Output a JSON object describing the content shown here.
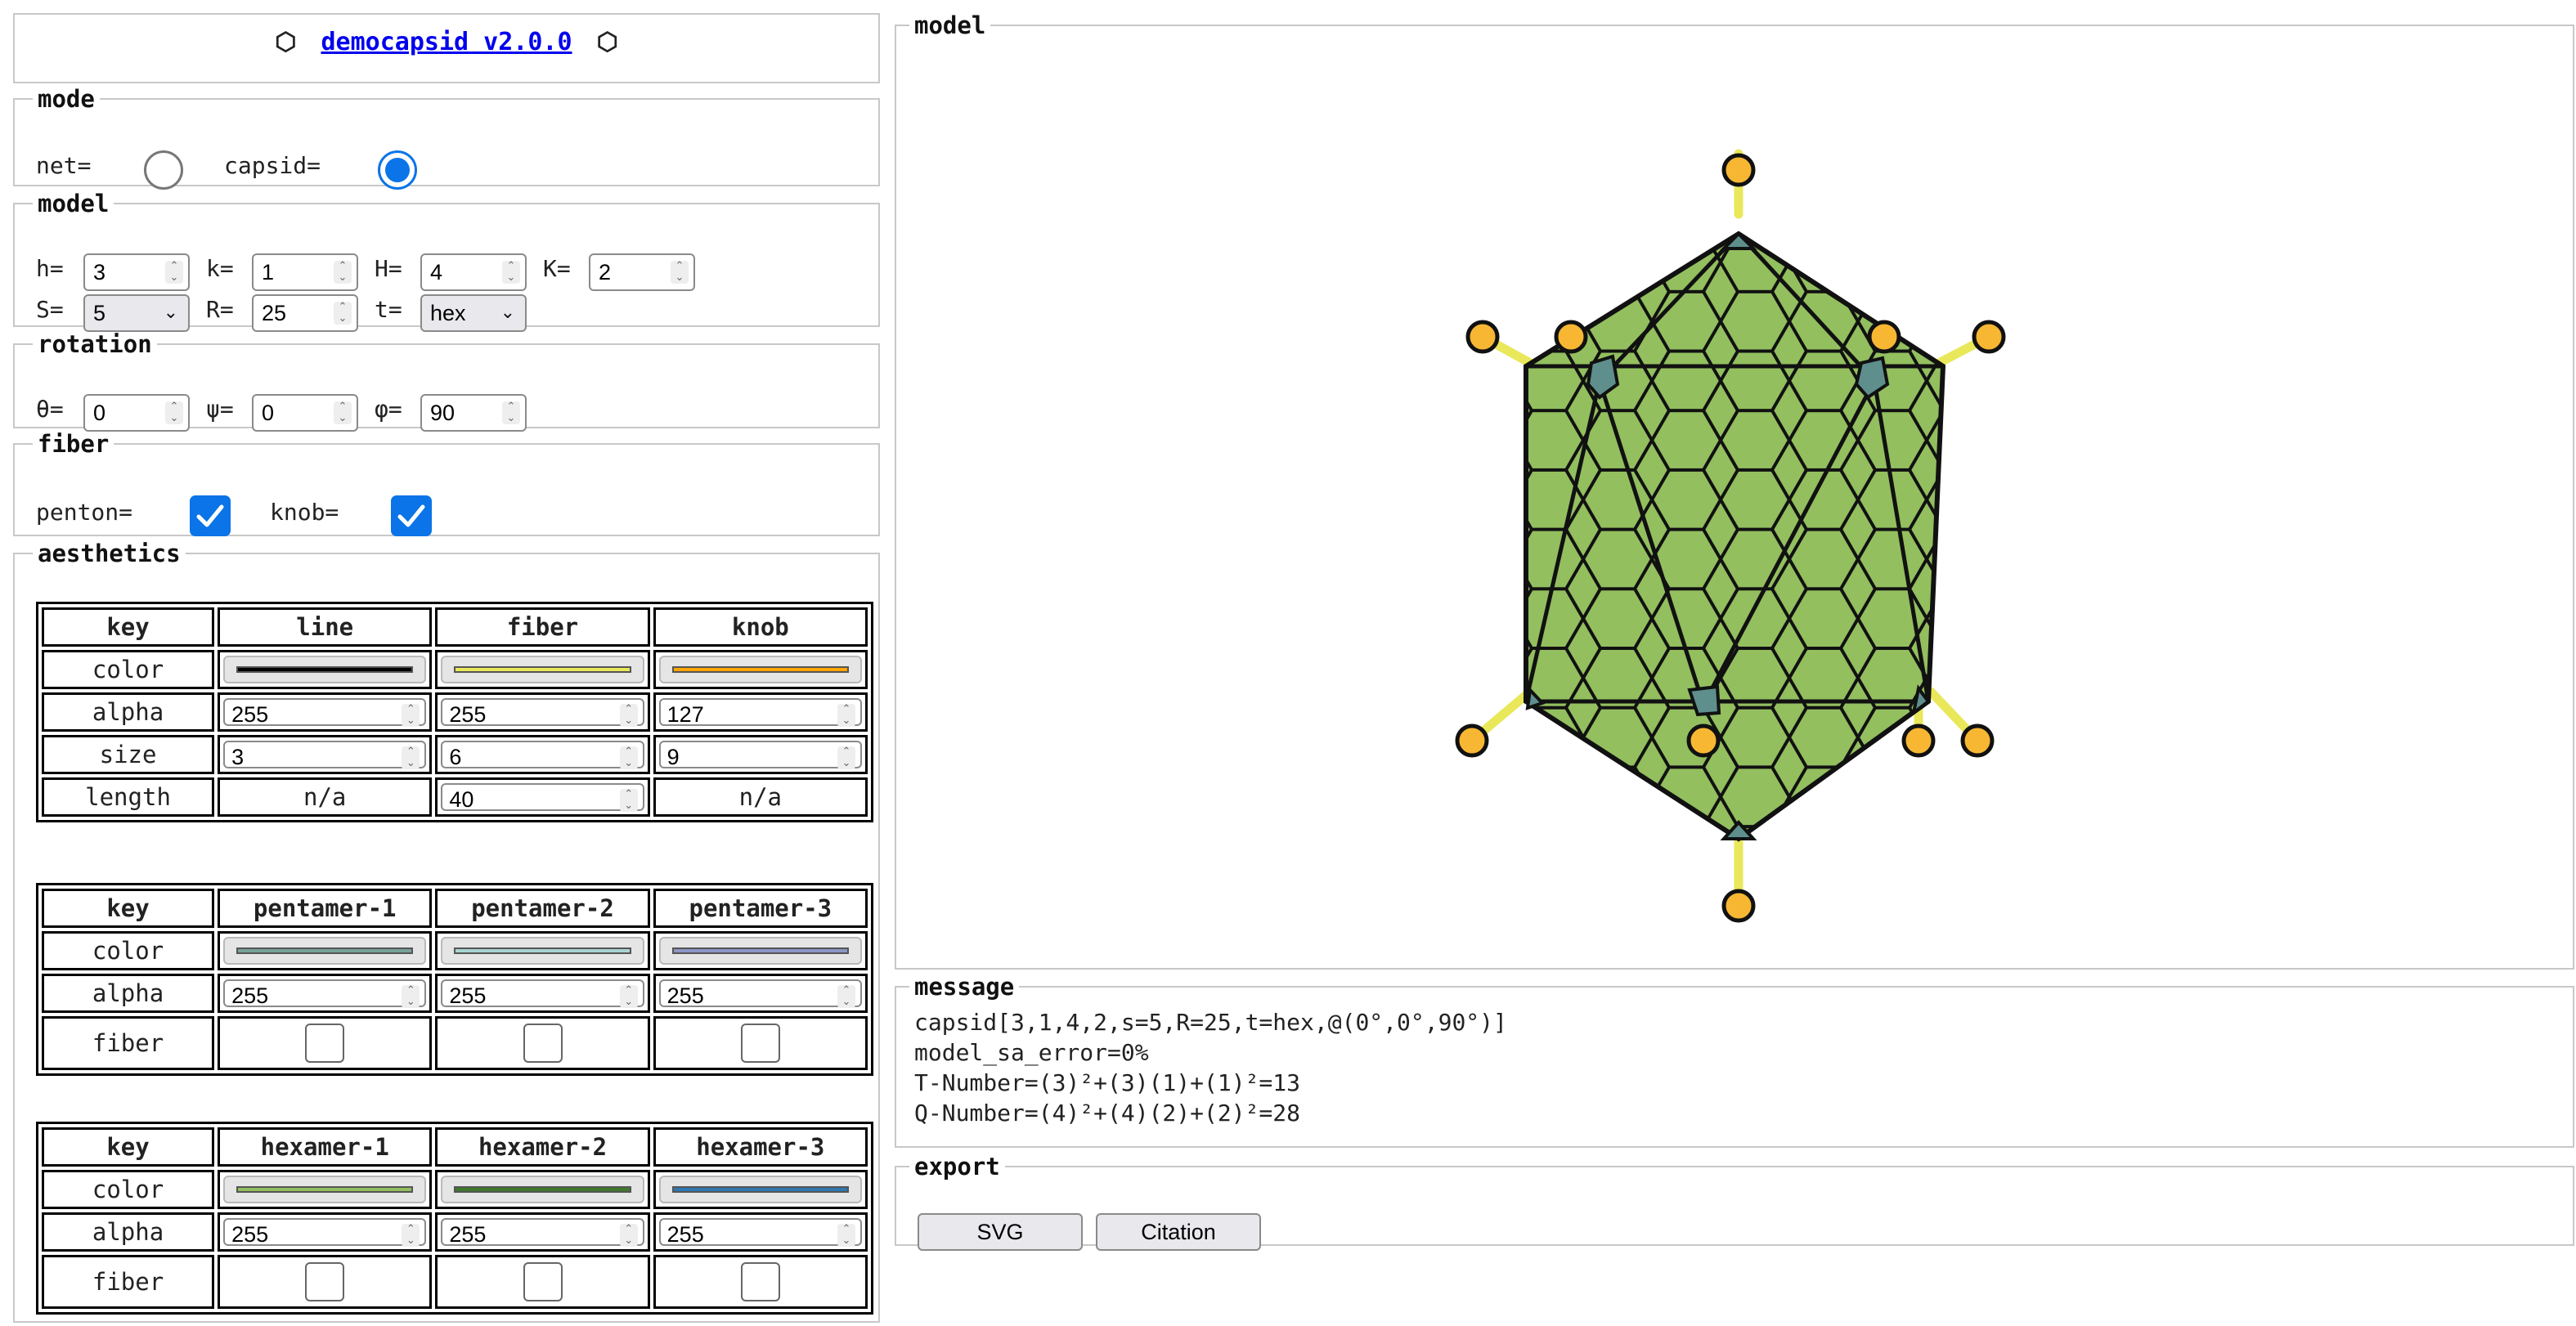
{
  "title": {
    "hex_left": "⬡",
    "link_text": "democapsid v2.0.0",
    "hex_right": "⬡"
  },
  "mode": {
    "legend": "mode",
    "net_label": "net=",
    "capsid_label": "capsid=",
    "selected": "capsid"
  },
  "model_panel": {
    "legend": "model",
    "h_label": "h=",
    "h_value": "3",
    "k_label": "k=",
    "k_value": "1",
    "H_label": "H=",
    "H_value": "4",
    "K_label": "K=",
    "K_value": "2",
    "S_label": "S=",
    "S_value": "5",
    "R_label": "R=",
    "R_value": "25",
    "t_label": "t=",
    "t_value": "hex"
  },
  "rotation": {
    "legend": "rotation",
    "theta_label": "θ=",
    "theta_value": "0",
    "psi_label": "ψ=",
    "psi_value": "0",
    "phi_label": "φ=",
    "phi_value": "90"
  },
  "fiber": {
    "legend": "fiber",
    "penton_label": "penton=",
    "penton_checked": true,
    "knob_label": "knob=",
    "knob_checked": true
  },
  "aesthetics": {
    "legend": "aesthetics",
    "table1": {
      "headers": [
        "key",
        "line",
        "fiber",
        "knob"
      ],
      "color_key": "color",
      "colors": [
        "#000000",
        "#e8e85a",
        "#ffa500"
      ],
      "alpha_key": "alpha",
      "alphas": [
        "255",
        "255",
        "127"
      ],
      "size_key": "size",
      "sizes": [
        "3",
        "6",
        "9"
      ],
      "length_key": "length",
      "length_line": "n/a",
      "length_fiber": "40",
      "length_knob": "n/a"
    },
    "table2": {
      "headers": [
        "key",
        "pentamer-1",
        "pentamer-2",
        "pentamer-3"
      ],
      "color_key": "color",
      "colors": [
        "#76a398",
        "#a8d4d2",
        "#8c96c6"
      ],
      "alpha_key": "alpha",
      "alphas": [
        "255",
        "255",
        "255"
      ],
      "fiber_key": "fiber"
    },
    "table3": {
      "headers": [
        "key",
        "hexamer-1",
        "hexamer-2",
        "hexamer-3"
      ],
      "color_key": "color",
      "colors": [
        "#93bf5f",
        "#3f7a2c",
        "#2f78b0"
      ],
      "alpha_key": "alpha",
      "alphas": [
        "255",
        "255",
        "255"
      ],
      "fiber_key": "fiber"
    }
  },
  "model_view": {
    "legend": "model"
  },
  "message": {
    "legend": "message",
    "lines": [
      "capsid[3,1,4,2,s=5,R=25,t=hex,@(0°,0°,90°)]",
      "model_sa_error=0%",
      "T-Number=(3)²+(3)(1)+(1)²=13",
      "Q-Number=(4)²+(4)(2)+(2)²=28"
    ]
  },
  "export": {
    "legend": "export",
    "svg_button": "SVG",
    "citation_button": "Citation"
  },
  "colors": {
    "accent": "#0a74e8",
    "hexamer": "#93bf5f",
    "pentamer": "#5e8f8c",
    "fiber": "#e8e85a",
    "knob": "#ffa500"
  }
}
